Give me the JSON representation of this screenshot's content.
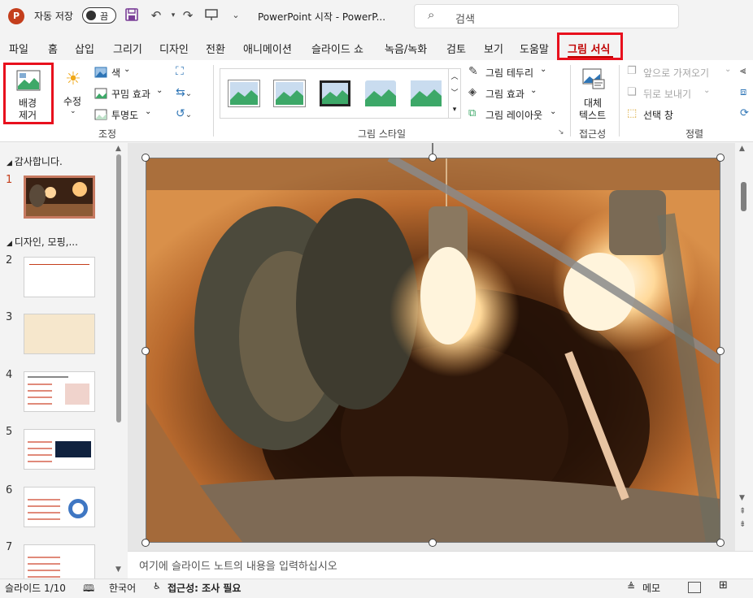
{
  "titlebar": {
    "autosave_label": "자동 저장",
    "autosave_state": "끔",
    "doc_title": "PowerPoint 시작  -  PowerP...",
    "search_placeholder": "검색"
  },
  "tabs": [
    {
      "label": "파일"
    },
    {
      "label": "홈"
    },
    {
      "label": "삽입"
    },
    {
      "label": "그리기"
    },
    {
      "label": "디자인"
    },
    {
      "label": "전환"
    },
    {
      "label": "애니메이션"
    },
    {
      "label": "슬라이드 쇼"
    },
    {
      "label": "녹음/녹화"
    },
    {
      "label": "검토"
    },
    {
      "label": "보기"
    },
    {
      "label": "도움말"
    },
    {
      "label": "그림 서식"
    }
  ],
  "ribbon": {
    "remove_bg_line1": "배경",
    "remove_bg_line2": "제거",
    "corrections": "수정",
    "color": "색",
    "artistic": "꾸밈 효과",
    "transparency": "투명도",
    "adjust_group": "조정",
    "styles_group": "그림 스타일",
    "border": "그림 테두리",
    "effects": "그림 효과",
    "layout": "그림 레이아웃",
    "alt_text_line1": "대체",
    "alt_text_line2": "텍스트",
    "accessibility_group": "접근성",
    "bring_forward": "앞으로 가져오기",
    "send_backward": "뒤로 보내기",
    "selection_pane": "선택 창",
    "arrange_group": "정렬"
  },
  "slides_panel": {
    "section1": "감사합니다.",
    "section2": "디자인, 모핑,...",
    "numbers": [
      "1",
      "2",
      "3",
      "4",
      "5",
      "6",
      "7"
    ]
  },
  "notes_placeholder": "여기에 슬라이드 노트의 내용을 입력하십시오",
  "statusbar": {
    "slide_info": "슬라이드 1/10",
    "language": "한국어",
    "accessibility": "접근성: 조사 필요",
    "notes": "메모"
  },
  "colors": {
    "accent_red": "#e8101d",
    "tab_active": "#c00000",
    "ppt_brand": "#c43e1c"
  }
}
